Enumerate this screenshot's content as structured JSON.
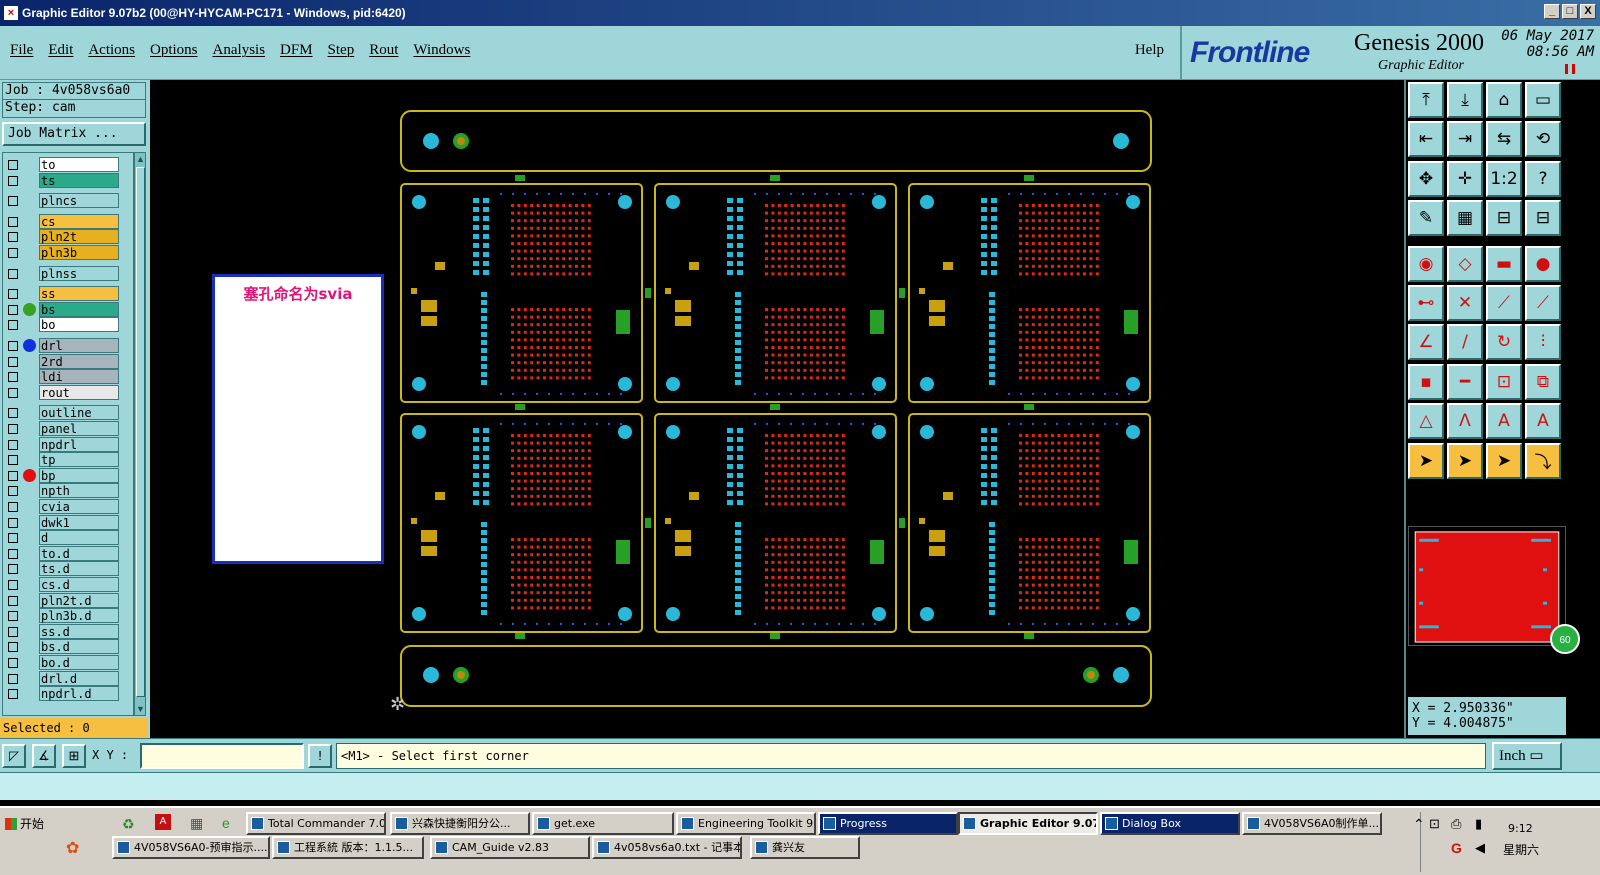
{
  "window": {
    "title": "Graphic Editor 9.07b2 (00@HY-HYCAM-PC171 - Windows, pid:6420)",
    "min_btn": "_",
    "max_btn": "□",
    "close_btn": "X"
  },
  "menu": {
    "items": [
      "File",
      "Edit",
      "Actions",
      "Options",
      "Analysis",
      "DFM",
      "Step",
      "Rout",
      "Windows"
    ],
    "help": "Help"
  },
  "brand": {
    "logo": "Frontline",
    "product": "Genesis 2000",
    "subtitle": "Graphic Editor",
    "date": "06 May 2017",
    "time": "08:56 AM"
  },
  "left_panel": {
    "job": "Job : 4v058vs6a0",
    "step": "Step: cam",
    "job_matrix": "Job Matrix ...",
    "selected": "Selected : 0",
    "layers": [
      {
        "name": "to",
        "color": "#ffffff",
        "dot": ""
      },
      {
        "name": "ts",
        "color": "#2aaa8a",
        "dot": ""
      },
      {
        "name": "plncs",
        "color": "#9fd6d9",
        "dot": ""
      },
      {
        "name": "cs",
        "color": "#f6bf40",
        "dot": ""
      },
      {
        "name": "pln2t",
        "color": "#e6b020",
        "dot": ""
      },
      {
        "name": "pln3b",
        "color": "#e6b020",
        "dot": ""
      },
      {
        "name": "plnss",
        "color": "#9fd6d9",
        "dot": ""
      },
      {
        "name": "ss",
        "color": "#f6bf40",
        "dot": ""
      },
      {
        "name": "bs",
        "color": "#2aaa8a",
        "dot": "#3aa020"
      },
      {
        "name": "bo",
        "color": "#ffffff",
        "dot": ""
      },
      {
        "name": "drl",
        "color": "#a8b4bc",
        "dot": "#1030e0"
      },
      {
        "name": "2rd",
        "color": "#a8b4bc",
        "dot": ""
      },
      {
        "name": "ldi",
        "color": "#a8b4bc",
        "dot": ""
      },
      {
        "name": "rout",
        "color": "#e8e8e8",
        "dot": ""
      },
      {
        "name": "outline",
        "color": "#9fd6d9",
        "dot": ""
      },
      {
        "name": "panel",
        "color": "#9fd6d9",
        "dot": ""
      },
      {
        "name": "npdrl",
        "color": "#9fd6d9",
        "dot": ""
      },
      {
        "name": "tp",
        "color": "#9fd6d9",
        "dot": ""
      },
      {
        "name": "bp",
        "color": "#9fd6d9",
        "dot": "#e01010"
      },
      {
        "name": "npth",
        "color": "#9fd6d9",
        "dot": ""
      },
      {
        "name": "cvia",
        "color": "#9fd6d9",
        "dot": ""
      },
      {
        "name": "dwk1",
        "color": "#9fd6d9",
        "dot": ""
      },
      {
        "name": "d",
        "color": "#9fd6d9",
        "dot": ""
      },
      {
        "name": "to.d",
        "color": "#9fd6d9",
        "dot": ""
      },
      {
        "name": "ts.d",
        "color": "#9fd6d9",
        "dot": ""
      },
      {
        "name": "cs.d",
        "color": "#9fd6d9",
        "dot": ""
      },
      {
        "name": "pln2t.d",
        "color": "#9fd6d9",
        "dot": ""
      },
      {
        "name": "pln3b.d",
        "color": "#9fd6d9",
        "dot": ""
      },
      {
        "name": "ss.d",
        "color": "#9fd6d9",
        "dot": ""
      },
      {
        "name": "bs.d",
        "color": "#9fd6d9",
        "dot": ""
      },
      {
        "name": "bo.d",
        "color": "#9fd6d9",
        "dot": ""
      },
      {
        "name": "drl.d",
        "color": "#9fd6d9",
        "dot": ""
      },
      {
        "name": "npdrl.d",
        "color": "#9fd6d9",
        "dot": ""
      }
    ]
  },
  "canvas": {
    "note": "塞孔命名为svia"
  },
  "coords": {
    "x": "X = 2.950336\"",
    "y": "Y = 4.004875\""
  },
  "minimap_badge": "60",
  "input_bar": {
    "xy_label": "X Y :",
    "xy_value": "",
    "prompt": "<M1> - Select first corner",
    "units": "Inch ▭"
  },
  "taskbar": {
    "start": "开始",
    "tasks_row1": [
      "Total Commander 7.0...",
      "兴森快捷衡阳分公...",
      "get.exe",
      "Engineering Toolkit 9....",
      "Progress",
      "Graphic Editor 9.07...",
      "Dialog Box",
      "4V058VS6A0制作单...."
    ],
    "tasks_row2": [
      "4V058VS6A0-预审指示....",
      "工程系統 版本：1.1.5...",
      "CAM_Guide v2.83",
      "4v058vs6a0.txt - 记事本",
      "龚兴友"
    ],
    "clock": "9:12",
    "weekday": "星期六"
  },
  "colors": {
    "panel": "#9fd6d9",
    "board_outline": "#c8b818",
    "pad_cyan": "#2ab8d8",
    "via_red": "#e02a10",
    "pad_green": "#28a028"
  }
}
